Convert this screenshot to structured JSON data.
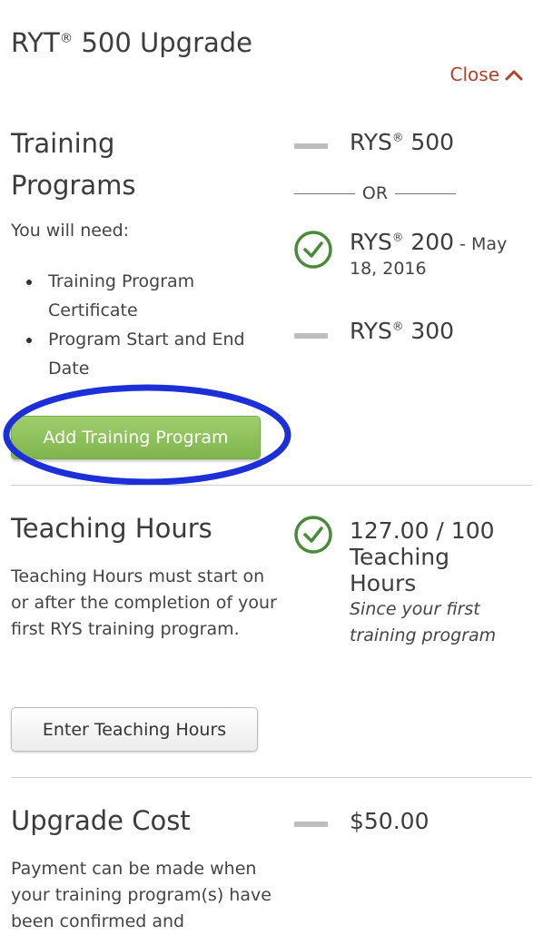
{
  "page": {
    "title_main": "RYT",
    "title_reg": "®",
    "title_rest": " 500 Upgrade",
    "close_label": "Close"
  },
  "training": {
    "heading_line1": "Training",
    "heading_line2": "Programs",
    "need_label": "You will need:",
    "requirements": [
      "Training Program Certificate",
      "Program Start and End Date"
    ],
    "add_button": "Add Training Program",
    "rys500": {
      "name": "RYS",
      "reg": "®",
      "level": " 500"
    },
    "or_label": "OR",
    "rys200": {
      "name": "RYS",
      "reg": "®",
      "level": " 200",
      "date_prefix": " - May",
      "date_rest": "18, 2016"
    },
    "rys300": {
      "name": "RYS",
      "reg": "®",
      "level": " 300"
    }
  },
  "teaching": {
    "heading": "Teaching Hours",
    "description": "Teaching Hours must start on or after the completion of your first RYS training program.",
    "button": "Enter Teaching Hours",
    "hours_line1": "127.00 / 100",
    "hours_line2": "Teaching",
    "hours_line3": "Hours",
    "since_line1": "Since your first",
    "since_line2": "training program"
  },
  "cost": {
    "heading": "Upgrade Cost",
    "amount": "$50.00",
    "description": "Payment can be made when your training program(s) have been confirmed and"
  },
  "colors": {
    "close": "#b3402a",
    "check": "#4a8a3a",
    "green_button": "#8cc05a",
    "annotation_ellipse": "#1d2fd6"
  },
  "icons": {
    "close": "chevron-up-icon",
    "status_complete": "check-circle-icon",
    "status_pending": "dash-icon"
  }
}
